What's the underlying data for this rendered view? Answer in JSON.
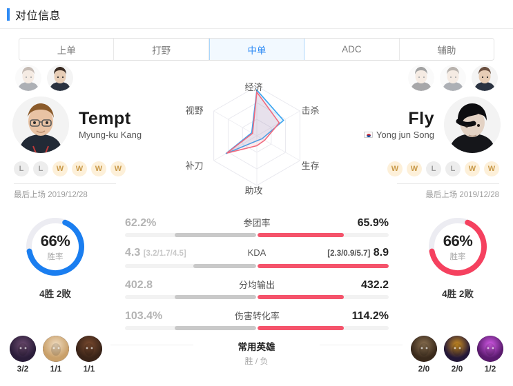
{
  "header": {
    "title": "对位信息",
    "accent_color": "#2e8bf5"
  },
  "tabs": [
    {
      "label": "上单",
      "active": false
    },
    {
      "label": "打野",
      "active": false
    },
    {
      "label": "中单",
      "active": true
    },
    {
      "label": "ADC",
      "active": false
    },
    {
      "label": "辅助",
      "active": false
    }
  ],
  "left_player": {
    "name": "Tempt",
    "real_name": "Myung-ku Kang",
    "has_flag": false,
    "record": [
      "L",
      "L",
      "W",
      "W",
      "W",
      "W"
    ],
    "last_play_label": "最后上场 2019/12/28",
    "win_rate": "66%",
    "win_rate_label": "胜率",
    "win_rate_value": 66,
    "record_summary": "4胜 2败",
    "ring_color": "#1a7ef0",
    "thumbs": [
      {
        "active": false
      },
      {
        "active": true
      }
    ],
    "champions": [
      {
        "wl": "3/2",
        "color1": "#2b1d3a",
        "color2": "#6b4a6e"
      },
      {
        "wl": "1/1",
        "color1": "#c9a06a",
        "color2": "#f0dcc0"
      },
      {
        "wl": "1/1",
        "color1": "#3a2418",
        "color2": "#7a4a2e"
      }
    ]
  },
  "right_player": {
    "name": "Fly",
    "real_name": "Yong jun Song",
    "has_flag": true,
    "record": [
      "W",
      "W",
      "L",
      "L",
      "W",
      "W"
    ],
    "last_play_label": "最后上场 2019/12/28",
    "win_rate": "66%",
    "win_rate_label": "胜率",
    "win_rate_value": 66,
    "record_summary": "4胜 2败",
    "ring_color": "#f5415f",
    "thumbs": [
      {
        "active": false
      },
      {
        "active": false
      },
      {
        "active": true
      }
    ],
    "champions": [
      {
        "wl": "2/0",
        "color1": "#3a2a1c",
        "color2": "#8a7050"
      },
      {
        "wl": "2/0",
        "color1": "#241838",
        "color2": "#d09020"
      },
      {
        "wl": "1/2",
        "color1": "#5a1a6e",
        "color2": "#d45ae8"
      }
    ]
  },
  "chart_data": {
    "type": "radar",
    "title": "",
    "axes": [
      "经济",
      "击杀",
      "生存",
      "助攻",
      "补刀",
      "视野"
    ],
    "range": [
      0,
      100
    ],
    "grid": true,
    "levels": 3,
    "series": [
      {
        "name": "Tempt",
        "color": "#3aa5f0",
        "values": [
          92,
          62,
          12,
          10,
          72,
          12
        ]
      },
      {
        "name": "Fly",
        "color": "#f06a7e",
        "values": [
          88,
          52,
          18,
          20,
          70,
          10
        ]
      }
    ]
  },
  "stats": [
    {
      "name": "参团率",
      "left_value": "62.2%",
      "left_sub": "",
      "right_value": "65.9%",
      "right_sub": "",
      "left_pct": 62.2,
      "right_pct": 65.9
    },
    {
      "name": "KDA",
      "left_value": "4.3",
      "left_sub": "[3.2/1.7/4.5]",
      "right_value": "8.9",
      "right_sub": "[2.3/0.9/5.7]",
      "left_pct": 48,
      "right_pct": 100
    },
    {
      "name": "分均输出",
      "left_value": "402.8",
      "left_sub": "",
      "right_value": "432.2",
      "right_sub": "",
      "left_pct": 62,
      "right_pct": 66
    },
    {
      "name": "伤害转化率",
      "left_value": "103.4%",
      "left_sub": "",
      "right_value": "114.2%",
      "right_sub": "",
      "left_pct": 62,
      "right_pct": 66
    }
  ],
  "champ_section": {
    "title": "常用英雄",
    "subtitle": "胜 / 负"
  }
}
